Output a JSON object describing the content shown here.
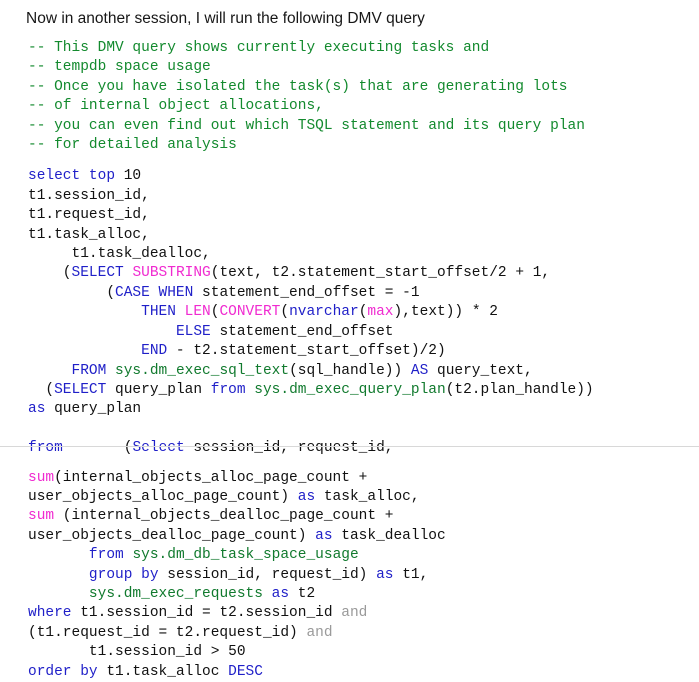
{
  "intro": {
    "text": "Now in another session, I will run the following DMV query"
  },
  "colors": {
    "comment": "#138a2e",
    "keyword": "#1f1fc8",
    "function": "#f02ad0",
    "system_object": "#117a2e",
    "operator_gray": "#9a9a9a",
    "plain": "#111111",
    "background": "#ffffff",
    "divider": "#d8d8d8"
  },
  "comments": [
    "-- This DMV query shows currently executing tasks and",
    "-- tempdb space usage",
    "-- Once you have isolated the task(s) that are generating lots",
    "-- of internal object allocations,",
    "-- you can even find out which TSQL statement and its query plan",
    "-- for detailed analysis"
  ],
  "query_upper": [
    [
      {
        "t": "select top",
        "c": "kw"
      },
      {
        "t": " 10",
        "c": "pl"
      }
    ],
    [
      {
        "t": "t1.session_id,",
        "c": "pl"
      }
    ],
    [
      {
        "t": "t1.request_id,",
        "c": "pl"
      }
    ],
    [
      {
        "t": "t1.task_alloc,",
        "c": "pl"
      }
    ],
    [
      {
        "t": "     t1.task_dealloc,",
        "c": "pl"
      }
    ],
    [
      {
        "t": "    (",
        "c": "pl"
      },
      {
        "t": "SELECT",
        "c": "kw"
      },
      {
        "t": " ",
        "c": "pl"
      },
      {
        "t": "SUBSTRING",
        "c": "fn"
      },
      {
        "t": "(text, t2.statement_start_offset/2 + 1,",
        "c": "pl"
      }
    ],
    [
      {
        "t": "         (",
        "c": "pl"
      },
      {
        "t": "CASE WHEN",
        "c": "kw"
      },
      {
        "t": " statement_end_offset = -1",
        "c": "pl"
      }
    ],
    [
      {
        "t": "             ",
        "c": "pl"
      },
      {
        "t": "THEN",
        "c": "kw"
      },
      {
        "t": " ",
        "c": "pl"
      },
      {
        "t": "LEN",
        "c": "fn"
      },
      {
        "t": "(",
        "c": "pl"
      },
      {
        "t": "CONVERT",
        "c": "fn"
      },
      {
        "t": "(",
        "c": "pl"
      },
      {
        "t": "nvarchar",
        "c": "kw"
      },
      {
        "t": "(",
        "c": "pl"
      },
      {
        "t": "max",
        "c": "fn"
      },
      {
        "t": "),text)) * 2",
        "c": "pl"
      }
    ],
    [
      {
        "t": "                 ",
        "c": "pl"
      },
      {
        "t": "ELSE",
        "c": "kw"
      },
      {
        "t": " statement_end_offset",
        "c": "pl"
      }
    ],
    [
      {
        "t": "             ",
        "c": "pl"
      },
      {
        "t": "END",
        "c": "kw"
      },
      {
        "t": " - t2.statement_start_offset)/2)",
        "c": "pl"
      }
    ],
    [
      {
        "t": "     ",
        "c": "pl"
      },
      {
        "t": "FROM",
        "c": "kw"
      },
      {
        "t": " ",
        "c": "pl"
      },
      {
        "t": "sys.dm_exec_sql_text",
        "c": "sys"
      },
      {
        "t": "(sql_handle)) ",
        "c": "pl"
      },
      {
        "t": "AS",
        "c": "kw"
      },
      {
        "t": " query_text,",
        "c": "pl"
      }
    ],
    [
      {
        "t": "  (",
        "c": "pl"
      },
      {
        "t": "SELECT",
        "c": "kw"
      },
      {
        "t": " query_plan ",
        "c": "pl"
      },
      {
        "t": "from",
        "c": "kw"
      },
      {
        "t": " ",
        "c": "pl"
      },
      {
        "t": "sys.dm_exec_query_plan",
        "c": "sys"
      },
      {
        "t": "(t2.plan_handle))",
        "c": "pl"
      }
    ],
    [
      {
        "t": "as",
        "c": "kw"
      },
      {
        "t": " query_plan",
        "c": "pl"
      }
    ],
    [
      {
        "t": "",
        "c": "pl"
      }
    ],
    [
      {
        "t": "from",
        "c": "kw"
      },
      {
        "t": "       (",
        "c": "pl"
      },
      {
        "t": "Select",
        "c": "kw"
      },
      {
        "t": " session_id, request_id,",
        "c": "pl"
      }
    ]
  ],
  "query_lower": [
    [
      {
        "t": "sum",
        "c": "fn"
      },
      {
        "t": "(internal_objects_alloc_page_count +",
        "c": "pl"
      }
    ],
    [
      {
        "t": "user_objects_alloc_page_count) ",
        "c": "pl"
      },
      {
        "t": "as",
        "c": "kw"
      },
      {
        "t": " task_alloc,",
        "c": "pl"
      }
    ],
    [
      {
        "t": "sum",
        "c": "fn"
      },
      {
        "t": " (internal_objects_dealloc_page_count +",
        "c": "pl"
      }
    ],
    [
      {
        "t": "user_objects_dealloc_page_count) ",
        "c": "pl"
      },
      {
        "t": "as",
        "c": "kw"
      },
      {
        "t": " task_dealloc",
        "c": "pl"
      }
    ],
    [
      {
        "t": "       ",
        "c": "pl"
      },
      {
        "t": "from",
        "c": "kw"
      },
      {
        "t": " ",
        "c": "pl"
      },
      {
        "t": "sys.dm_db_task_space_usage",
        "c": "sys"
      }
    ],
    [
      {
        "t": "       ",
        "c": "pl"
      },
      {
        "t": "group by",
        "c": "kw"
      },
      {
        "t": " session_id, request_id) ",
        "c": "pl"
      },
      {
        "t": "as",
        "c": "kw"
      },
      {
        "t": " t1,",
        "c": "pl"
      }
    ],
    [
      {
        "t": "       ",
        "c": "pl"
      },
      {
        "t": "sys.dm_exec_requests",
        "c": "sys"
      },
      {
        "t": " ",
        "c": "pl"
      },
      {
        "t": "as",
        "c": "kw"
      },
      {
        "t": " t2",
        "c": "pl"
      }
    ],
    [
      {
        "t": "where",
        "c": "kw"
      },
      {
        "t": " t1.session_id = t2.session_id ",
        "c": "pl"
      },
      {
        "t": "and",
        "c": "gry"
      }
    ],
    [
      {
        "t": "(t1.request_id = t2.request_id) ",
        "c": "pl"
      },
      {
        "t": "and",
        "c": "gry"
      }
    ],
    [
      {
        "t": "       t1.session_id > 50",
        "c": "pl"
      }
    ],
    [
      {
        "t": "order by",
        "c": "kw"
      },
      {
        "t": " t1.task_alloc ",
        "c": "pl"
      },
      {
        "t": "DESC",
        "c": "kw"
      }
    ]
  ]
}
